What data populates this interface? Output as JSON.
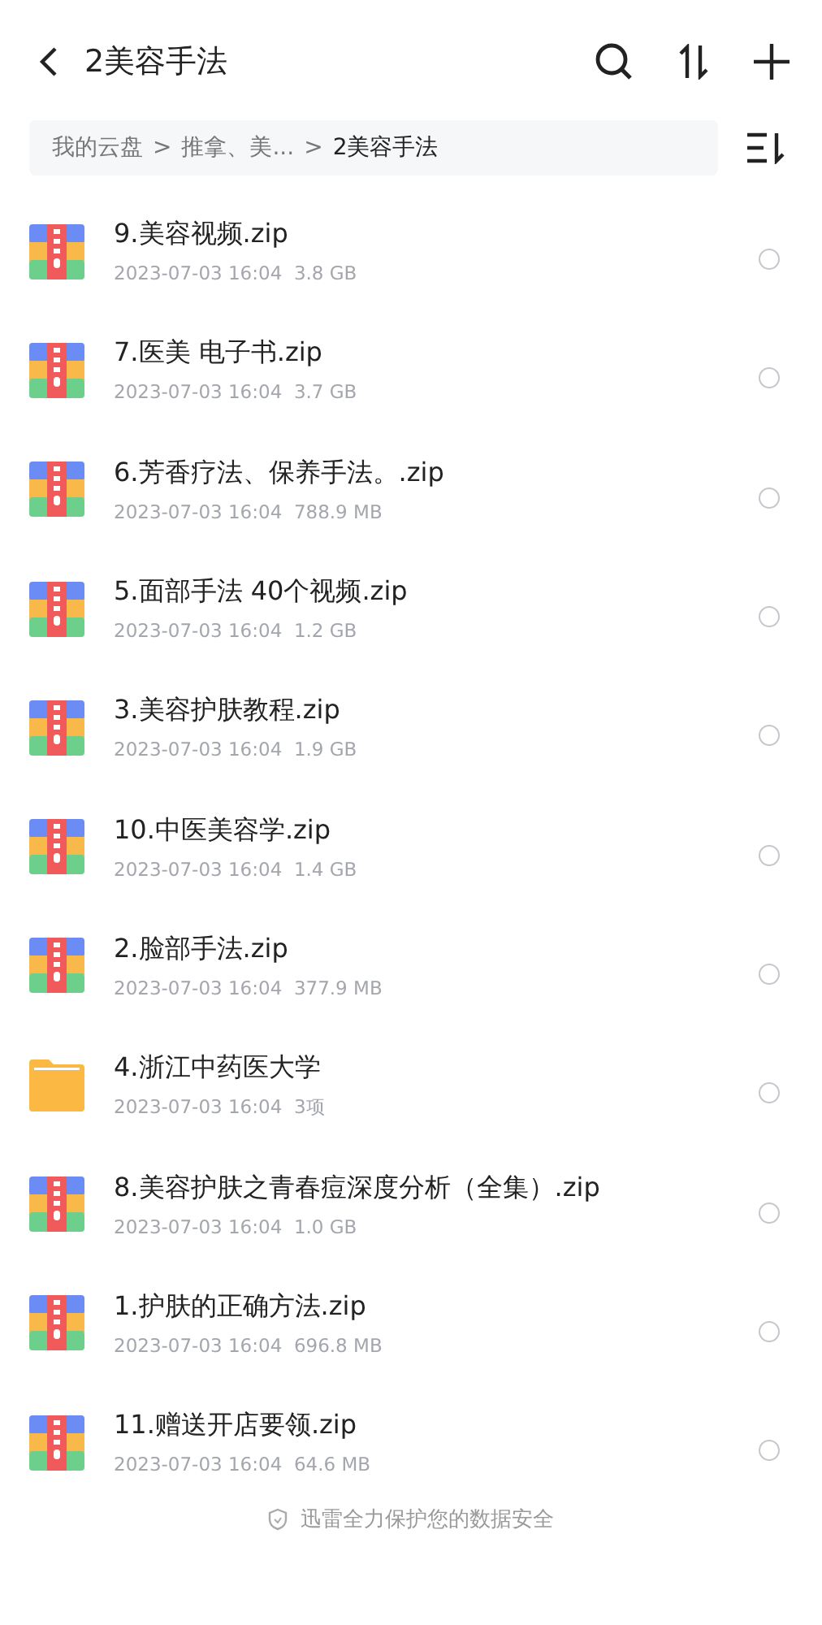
{
  "header": {
    "title": "2美容手法"
  },
  "breadcrumb": [
    {
      "kind": "link",
      "label": "我的云盘",
      "current": false
    },
    {
      "kind": "separator",
      "label": ">"
    },
    {
      "kind": "link",
      "label": "推拿、美...",
      "current": false
    },
    {
      "kind": "separator",
      "label": ">"
    },
    {
      "kind": "link",
      "label": "2美容手法",
      "current": true
    }
  ],
  "files": [
    {
      "kind": "zip",
      "name": "9.美容视频.zip",
      "date": "2023-07-03 16:04",
      "size": "3.8 GB",
      "selected": false
    },
    {
      "kind": "zip",
      "name": "7.医美 电子书.zip",
      "date": "2023-07-03 16:04",
      "size": "3.7 GB",
      "selected": false
    },
    {
      "kind": "zip",
      "name": "6.芳香疗法、保养手法。.zip",
      "date": "2023-07-03 16:04",
      "size": "788.9 MB",
      "selected": false
    },
    {
      "kind": "zip",
      "name": "5.面部手法 40个视频.zip",
      "date": "2023-07-03 16:04",
      "size": "1.2 GB",
      "selected": false
    },
    {
      "kind": "zip",
      "name": "3.美容护肤教程.zip",
      "date": "2023-07-03 16:04",
      "size": "1.9 GB",
      "selected": false
    },
    {
      "kind": "zip",
      "name": "10.中医美容学.zip",
      "date": "2023-07-03 16:04",
      "size": "1.4 GB",
      "selected": false
    },
    {
      "kind": "zip",
      "name": "2.脸部手法.zip",
      "date": "2023-07-03 16:04",
      "size": "377.9 MB",
      "selected": false
    },
    {
      "kind": "folder",
      "name": "4.浙江中药医大学",
      "date": "2023-07-03 16:04",
      "size": "3项",
      "selected": false
    },
    {
      "kind": "zip",
      "name": "8.美容护肤之青春痘深度分析（全集）.zip",
      "date": "2023-07-03 16:04",
      "size": "1.0 GB",
      "selected": false
    },
    {
      "kind": "zip",
      "name": "1.护肤的正确方法.zip",
      "date": "2023-07-03 16:04",
      "size": "696.8 MB",
      "selected": false
    },
    {
      "kind": "zip",
      "name": "11.赠送开店要领.zip",
      "date": "2023-07-03 16:04",
      "size": "64.6 MB",
      "selected": false
    }
  ],
  "footer": {
    "text": "迅雷全力保护您的数据安全"
  }
}
